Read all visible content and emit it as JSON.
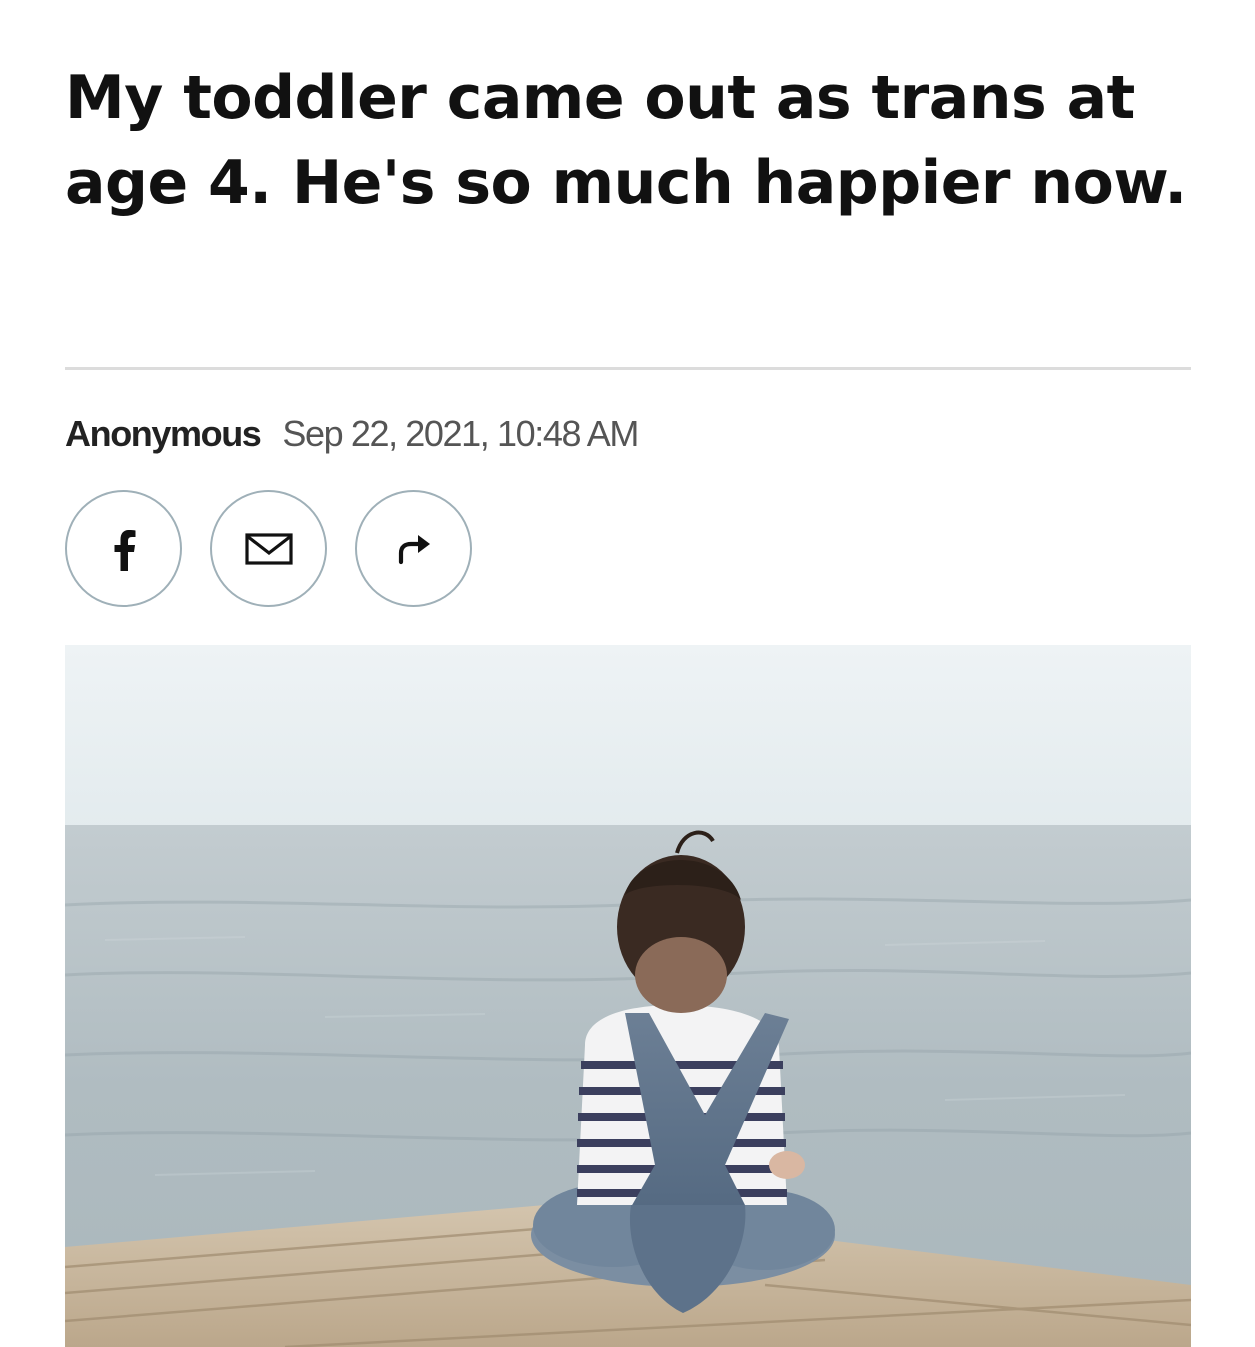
{
  "article": {
    "headline": "My toddler came out as trans at age 4. He's so much happier now.",
    "author": "Anonymous",
    "timestamp": "Sep 22, 2021, 10:48 AM"
  },
  "share": {
    "buttons": [
      {
        "icon": "facebook-icon"
      },
      {
        "icon": "mail-icon"
      },
      {
        "icon": "share-arrow-icon"
      }
    ]
  },
  "hero_image": {
    "subject": "child-sitting-on-dock-facing-sea",
    "colors": {
      "sky": "#e9f0f2",
      "sea": "#a9b6bb",
      "dock": "#c9b8a0",
      "overalls": "#5f748d",
      "hair": "#3a2a22"
    }
  },
  "theme": {
    "divider": "#dcdcdc",
    "button_border": "#9fb0b8"
  }
}
